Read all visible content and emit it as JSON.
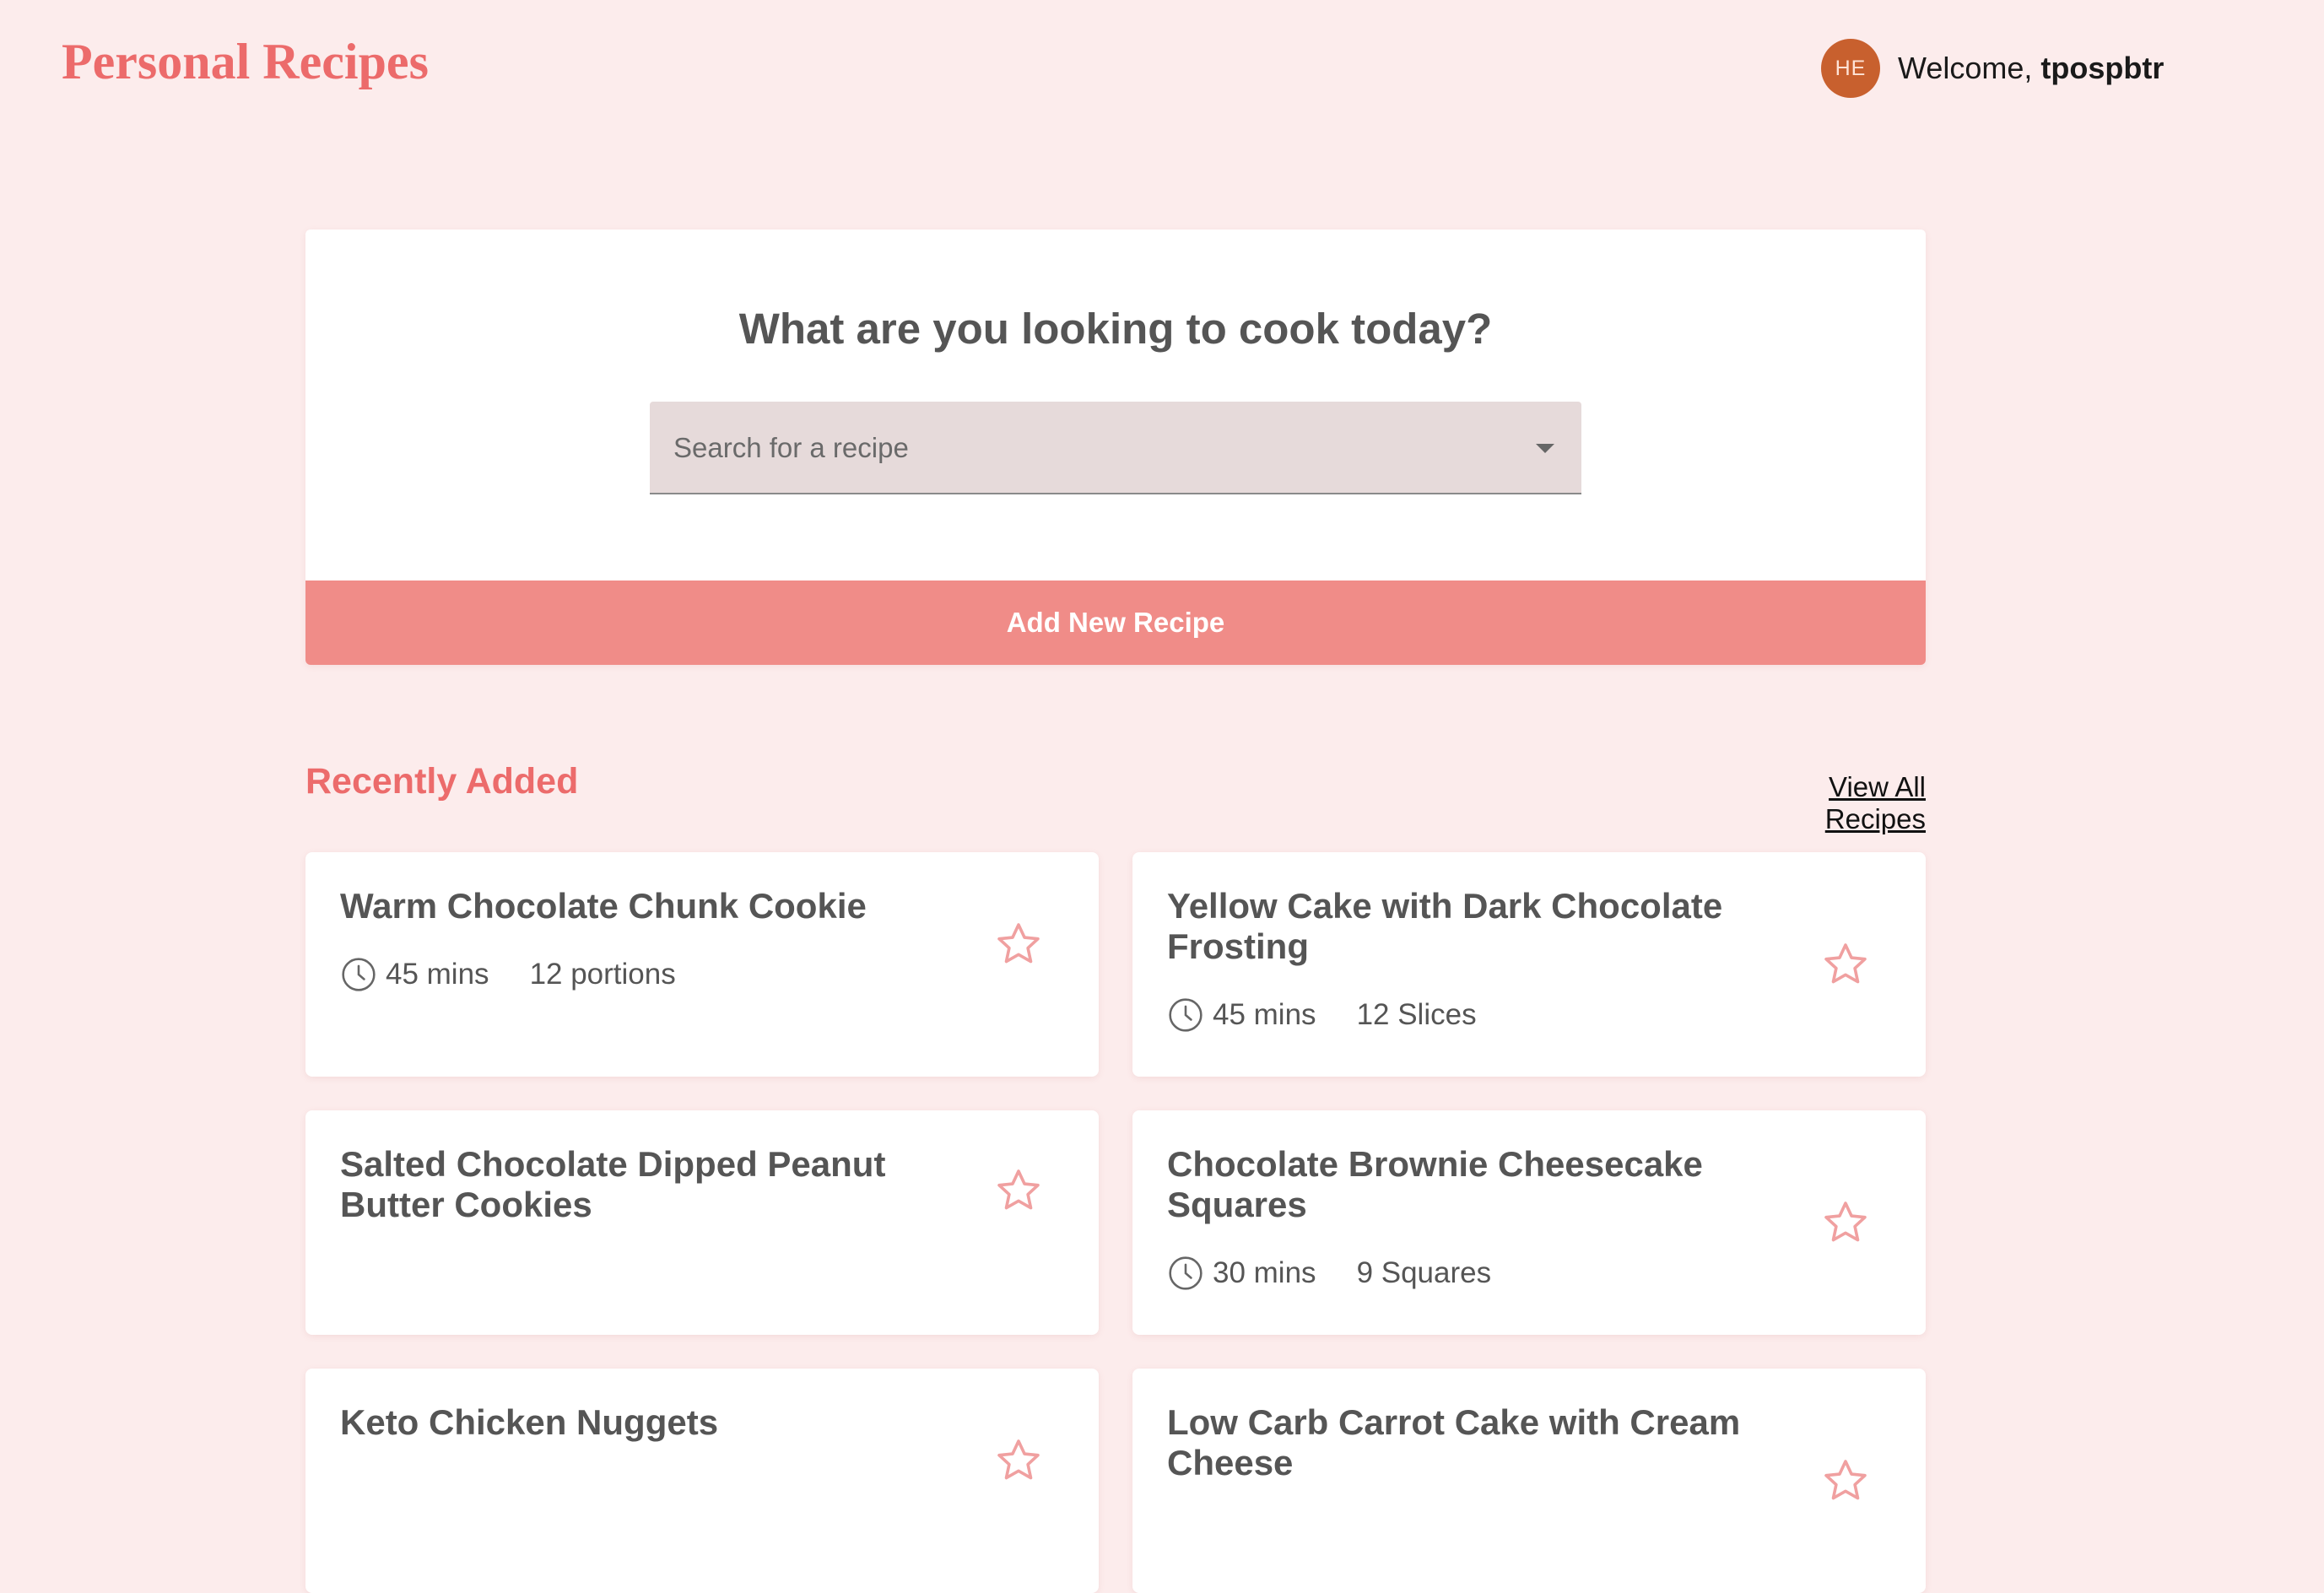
{
  "header": {
    "app_title": "Personal Recipes",
    "avatar_initials": "HE",
    "welcome_prefix": "Welcome, ",
    "username": "tpospbtr"
  },
  "search": {
    "heading": "What are you looking to cook today?",
    "placeholder": "Search for a recipe",
    "add_button_label": "Add New Recipe"
  },
  "recent": {
    "title": "Recently Added",
    "view_all_label": "View All Recipes",
    "recipes": [
      {
        "title": "Warm Chocolate Chunk Cookie",
        "time": "45 mins",
        "servings": "12 portions"
      },
      {
        "title": "Yellow Cake with Dark Chocolate Frosting",
        "time": "45 mins",
        "servings": "12 Slices"
      },
      {
        "title": "Salted Chocolate Dipped Peanut Butter Cookies",
        "time": "",
        "servings": ""
      },
      {
        "title": "Chocolate Brownie Cheesecake Squares",
        "time": "30 mins",
        "servings": "9 Squares"
      },
      {
        "title": "Keto Chicken Nuggets",
        "time": "",
        "servings": ""
      },
      {
        "title": "Low Carb Carrot Cake with Cream Cheese",
        "time": "",
        "servings": ""
      }
    ]
  },
  "colors": {
    "background": "#fcecec",
    "brand": "#ec6b6b",
    "button": "#f08c88",
    "avatar": "#c8602e",
    "star": "#f0a0a0"
  },
  "icons": {
    "time": "clock-icon",
    "favorite": "star-outline-icon"
  }
}
